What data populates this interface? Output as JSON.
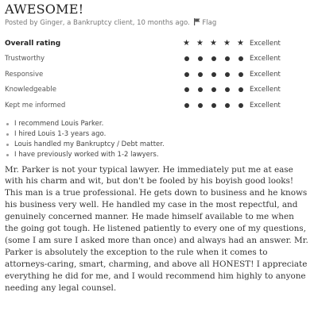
{
  "review": {
    "title": "AWESOME!",
    "meta_prefix": "Posted by Ginger, a Bankruptcy client, 10 months ago.",
    "flag_label": "Flag",
    "ratings": [
      {
        "label": "Overall rating",
        "score": 5,
        "max": 5,
        "style": "stars",
        "text": "Excellent"
      },
      {
        "label": "Trustworthy",
        "score": 5,
        "max": 5,
        "style": "dots",
        "text": "Excellent"
      },
      {
        "label": "Responsive",
        "score": 5,
        "max": 5,
        "style": "dots",
        "text": "Excellent"
      },
      {
        "label": "Knowledgeable",
        "score": 5,
        "max": 5,
        "style": "dots",
        "text": "Excellent"
      },
      {
        "label": "Kept me informed",
        "score": 5,
        "max": 5,
        "style": "dots",
        "text": "Excellent"
      }
    ],
    "facts": [
      "I recommend Louis Parker.",
      "I hired Louis 1-3 years ago.",
      "Louis handled my Bankruptcy / Debt matter.",
      "I have previously worked with 1-2 lawyers."
    ],
    "body": "Mr. Parker is not your typical lawyer. He immediately put me at ease with his charm and wit, but don't be fooled by his boyish good looks! This man is a true professional. He gets down to business and he knows his business very well. He handled my case in the most repectful, and genuinely concerned manner. He made himself available to me when the going got tough. He listened patiently to every one of my questions, (some I am sure I asked more than once) and always had an answer. Mr. Parker is absolutely the exception to the rule when it comes to attorneys-caring, smart, charming, and above all HONEST! I appreciate everything he did for me, and I would recommend him highly to anyone needing any legal counsel."
  }
}
